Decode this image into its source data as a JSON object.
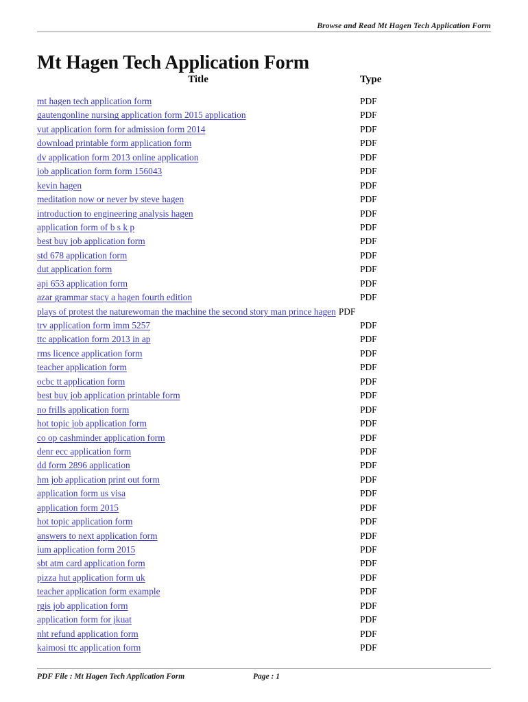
{
  "header": {
    "running_title": "Browse and Read Mt Hagen Tech Application Form"
  },
  "document": {
    "title": "Mt Hagen Tech Application Form"
  },
  "table": {
    "columns": {
      "title": "Title",
      "type": "Type"
    },
    "rows": [
      {
        "title": "mt hagen tech application form",
        "type": "PDF"
      },
      {
        "title": "gautengonline nursing application form 2015 application",
        "type": "PDF"
      },
      {
        "title": "vut application form for admission form 2014",
        "type": "PDF"
      },
      {
        "title": "download printable form application form",
        "type": "PDF"
      },
      {
        "title": "dv application form 2013 online application",
        "type": "PDF"
      },
      {
        "title": "job application form form 156043",
        "type": "PDF"
      },
      {
        "title": "kevin hagen",
        "type": "PDF"
      },
      {
        "title": "meditation now or never by steve hagen",
        "type": "PDF"
      },
      {
        "title": "introduction to engineering analysis hagen",
        "type": "PDF"
      },
      {
        "title": "application form of b s k p",
        "type": "PDF"
      },
      {
        "title": "best buy job application form",
        "type": "PDF"
      },
      {
        "title": "std 678 application form",
        "type": "PDF"
      },
      {
        "title": "dut application form",
        "type": "PDF"
      },
      {
        "title": "api 653 application form",
        "type": "PDF"
      },
      {
        "title": "azar grammar stacy a hagen fourth edition",
        "type": "PDF"
      },
      {
        "title": "plays of protest the naturewoman the machine the second story man prince hagen",
        "type": "PDF",
        "long": true
      },
      {
        "title": "trv application form imm 5257",
        "type": "PDF"
      },
      {
        "title": "ttc application form 2013 in ap",
        "type": "PDF"
      },
      {
        "title": "rms licence application form",
        "type": "PDF"
      },
      {
        "title": "teacher application form",
        "type": "PDF"
      },
      {
        "title": "ocbc tt application form",
        "type": "PDF"
      },
      {
        "title": "best buy job application printable form",
        "type": "PDF"
      },
      {
        "title": "no frills application form",
        "type": "PDF"
      },
      {
        "title": "hot topic job application form",
        "type": "PDF"
      },
      {
        "title": "co op cashminder application form",
        "type": "PDF"
      },
      {
        "title": "denr ecc application form",
        "type": "PDF"
      },
      {
        "title": "dd form 2896 application",
        "type": "PDF"
      },
      {
        "title": "hm job application print out form",
        "type": "PDF"
      },
      {
        "title": "application form us visa",
        "type": "PDF"
      },
      {
        "title": "application form 2015",
        "type": "PDF"
      },
      {
        "title": "hot topic application form",
        "type": "PDF"
      },
      {
        "title": "answers to next application form",
        "type": "PDF"
      },
      {
        "title": "ium application form 2015",
        "type": "PDF"
      },
      {
        "title": "sbt atm card application form",
        "type": "PDF"
      },
      {
        "title": "pizza hut application form uk",
        "type": "PDF"
      },
      {
        "title": "teacher application form example",
        "type": "PDF"
      },
      {
        "title": "rgis job application form",
        "type": "PDF"
      },
      {
        "title": "application form for jkuat",
        "type": "PDF"
      },
      {
        "title": "nht refund application form",
        "type": "PDF"
      },
      {
        "title": "kaimosi ttc application form",
        "type": "PDF"
      }
    ]
  },
  "footer": {
    "file_label": "PDF File : Mt Hagen Tech Application Form",
    "page_label": "Page : 1"
  },
  "colors": {
    "link": "#3535cc",
    "rule": "#8a8a8a",
    "text": "#000000",
    "background": "#ffffff"
  }
}
